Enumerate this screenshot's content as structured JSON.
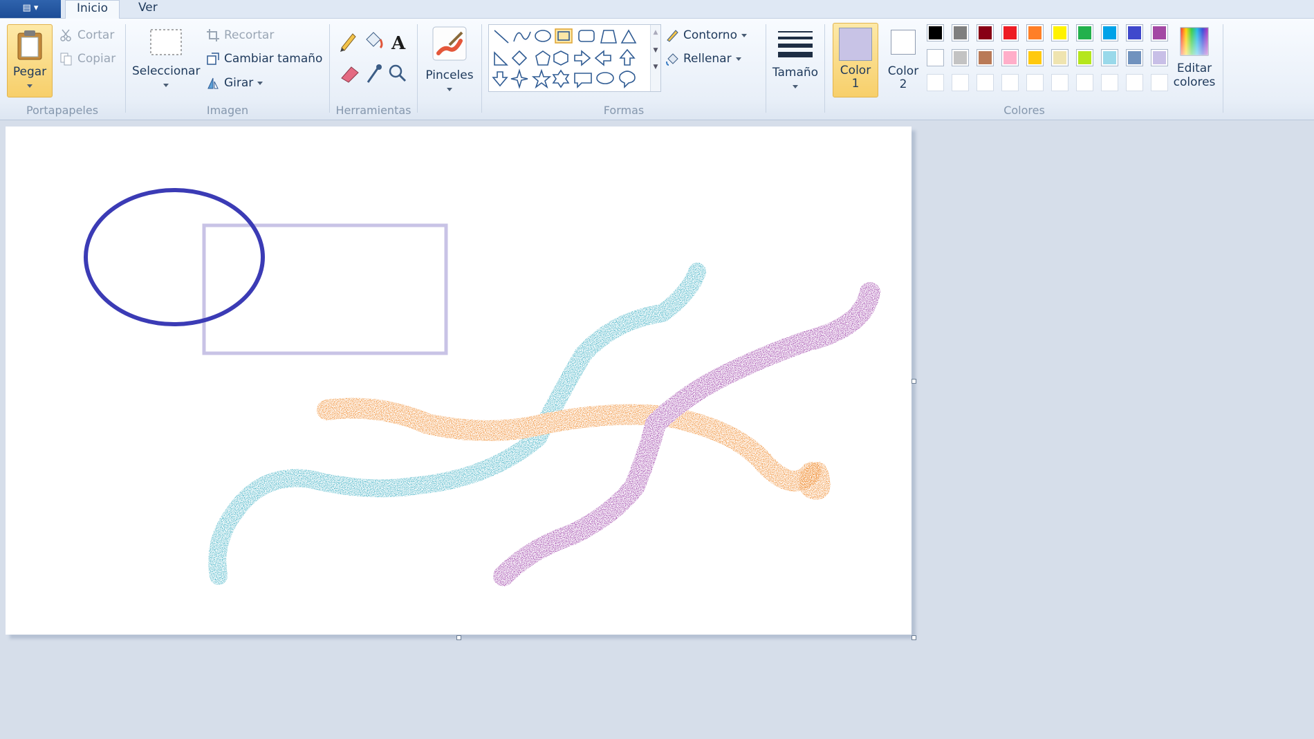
{
  "tabs": {
    "inicio": "Inicio",
    "ver": "Ver"
  },
  "clipboard": {
    "paste": "Pegar",
    "cut": "Cortar",
    "copy": "Copiar",
    "group": "Portapapeles"
  },
  "image": {
    "select": "Seleccionar",
    "crop": "Recortar",
    "resize": "Cambiar tamaño",
    "rotate": "Girar",
    "group": "Imagen"
  },
  "tools": {
    "group": "Herramientas"
  },
  "brushes": {
    "label": "Pinceles"
  },
  "shapes": {
    "outline": "Contorno",
    "fill": "Rellenar",
    "group": "Formas"
  },
  "size": {
    "label": "Tamaño"
  },
  "colors": {
    "color1_label": "Color",
    "color1_num": "1",
    "color2_label": "Color",
    "color2_num": "2",
    "edit_line1": "Editar",
    "edit_line2": "colores",
    "group": "Colores",
    "color1": "#c8c3e6",
    "color2": "#ffffff",
    "palette_row1": [
      "#000000",
      "#7f7f7f",
      "#880015",
      "#ed1c24",
      "#ff7f27",
      "#fff200",
      "#22b14c",
      "#00a2e8",
      "#3f48cc",
      "#a349a4"
    ],
    "palette_row2": [
      "#ffffff",
      "#c3c3c3",
      "#b97a57",
      "#ffaec9",
      "#ffc90e",
      "#efe4b0",
      "#b5e61d",
      "#99d9ea",
      "#7092be",
      "#c8bfe7"
    ]
  },
  "drawing": {
    "ellipse_color": "#3b3bb5",
    "rect_color": "#c8c3e6",
    "teal": "#3fb0c4",
    "orange": "#f08a2c",
    "purple": "#9c3fa8"
  }
}
